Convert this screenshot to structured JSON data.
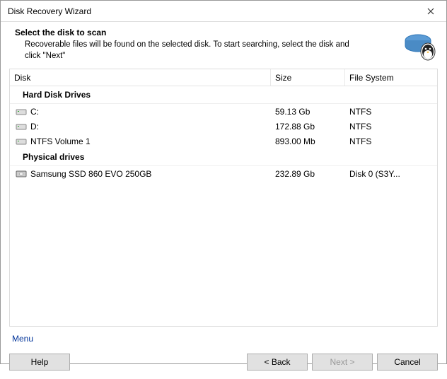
{
  "window": {
    "title": "Disk Recovery Wizard"
  },
  "header": {
    "title": "Select the disk to scan",
    "description": "Recoverable files will be found on the selected disk. To start searching, select the disk and click \"Next\""
  },
  "columns": {
    "disk": "Disk",
    "size": "Size",
    "filesystem": "File System"
  },
  "groups": {
    "hard_disks": "Hard Disk Drives",
    "physical": "Physical drives"
  },
  "disks": [
    {
      "name": "C:",
      "size": "59.13 Gb",
      "fs": "NTFS"
    },
    {
      "name": "D:",
      "size": "172.88 Gb",
      "fs": "NTFS"
    },
    {
      "name": "NTFS Volume 1",
      "size": "893.00 Mb",
      "fs": "NTFS"
    }
  ],
  "physical": [
    {
      "name": "Samsung SSD 860 EVO 250GB",
      "size": "232.89 Gb",
      "fs": "Disk 0 (S3Y..."
    }
  ],
  "menu": {
    "label": "Menu"
  },
  "buttons": {
    "help": "Help",
    "back": "< Back",
    "next": "Next >",
    "cancel": "Cancel"
  }
}
